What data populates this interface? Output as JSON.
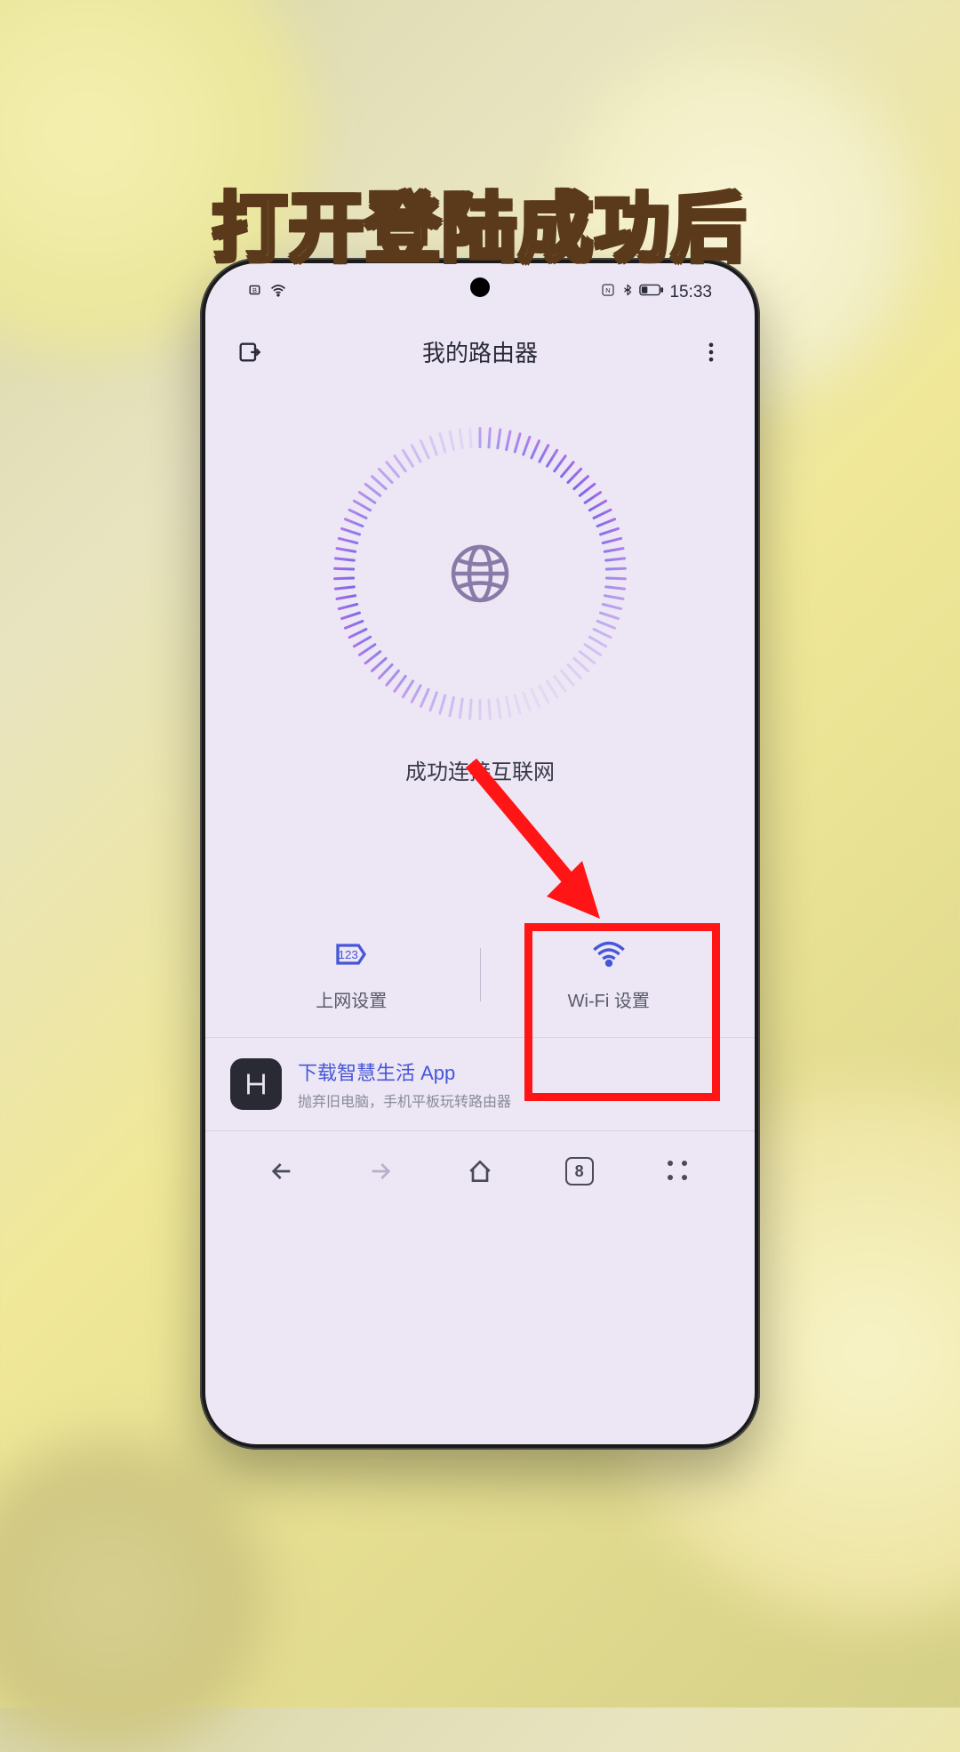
{
  "caption": "打开登陆成功后",
  "status": {
    "time": "15:33",
    "nfc": "N",
    "bt": "✻",
    "battery_icon": "▢",
    "left_indicator": "B",
    "wifi": "⋮"
  },
  "header": {
    "title": "我的路由器"
  },
  "connection": {
    "status_text": "成功连接互联网"
  },
  "options": {
    "network": "上网设置",
    "wifi": "Wi-Fi 设置"
  },
  "promo": {
    "title": "下载智慧生活 App",
    "subtitle": "抛弃旧电脑，手机平板玩转路由器"
  },
  "browser": {
    "tab_count": "8"
  }
}
